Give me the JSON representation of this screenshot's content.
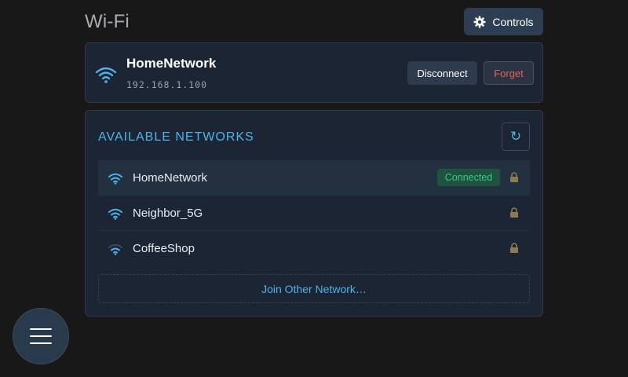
{
  "header": {
    "title": "Wi-Fi",
    "controls_label": "Controls",
    "controls_icon": "gear-icon"
  },
  "current_network": {
    "name": "HomeNetwork",
    "ip": "192.168.1.100",
    "disconnect_label": "Disconnect",
    "forget_label": "Forget",
    "icon": "wifi-icon"
  },
  "available": {
    "heading": "AVAILABLE NETWORKS",
    "refresh_icon": "refresh-icon",
    "refresh_glyph": "↻",
    "networks": [
      {
        "ssid": "HomeNetwork",
        "status": "Connected",
        "signal": 3,
        "secured": true
      },
      {
        "ssid": "Neighbor_5G",
        "status": "",
        "signal": 3,
        "secured": true
      },
      {
        "ssid": "CoffeeShop",
        "status": "",
        "signal": 2,
        "secured": true
      }
    ],
    "join_label": "Join Other Network…"
  },
  "menu": {
    "icon": "hamburger-menu-icon"
  },
  "colors": {
    "accent": "#4fb3e8",
    "success": "#36c98a",
    "danger": "#e0645c",
    "background": "#181818",
    "card": "#1b2534"
  }
}
